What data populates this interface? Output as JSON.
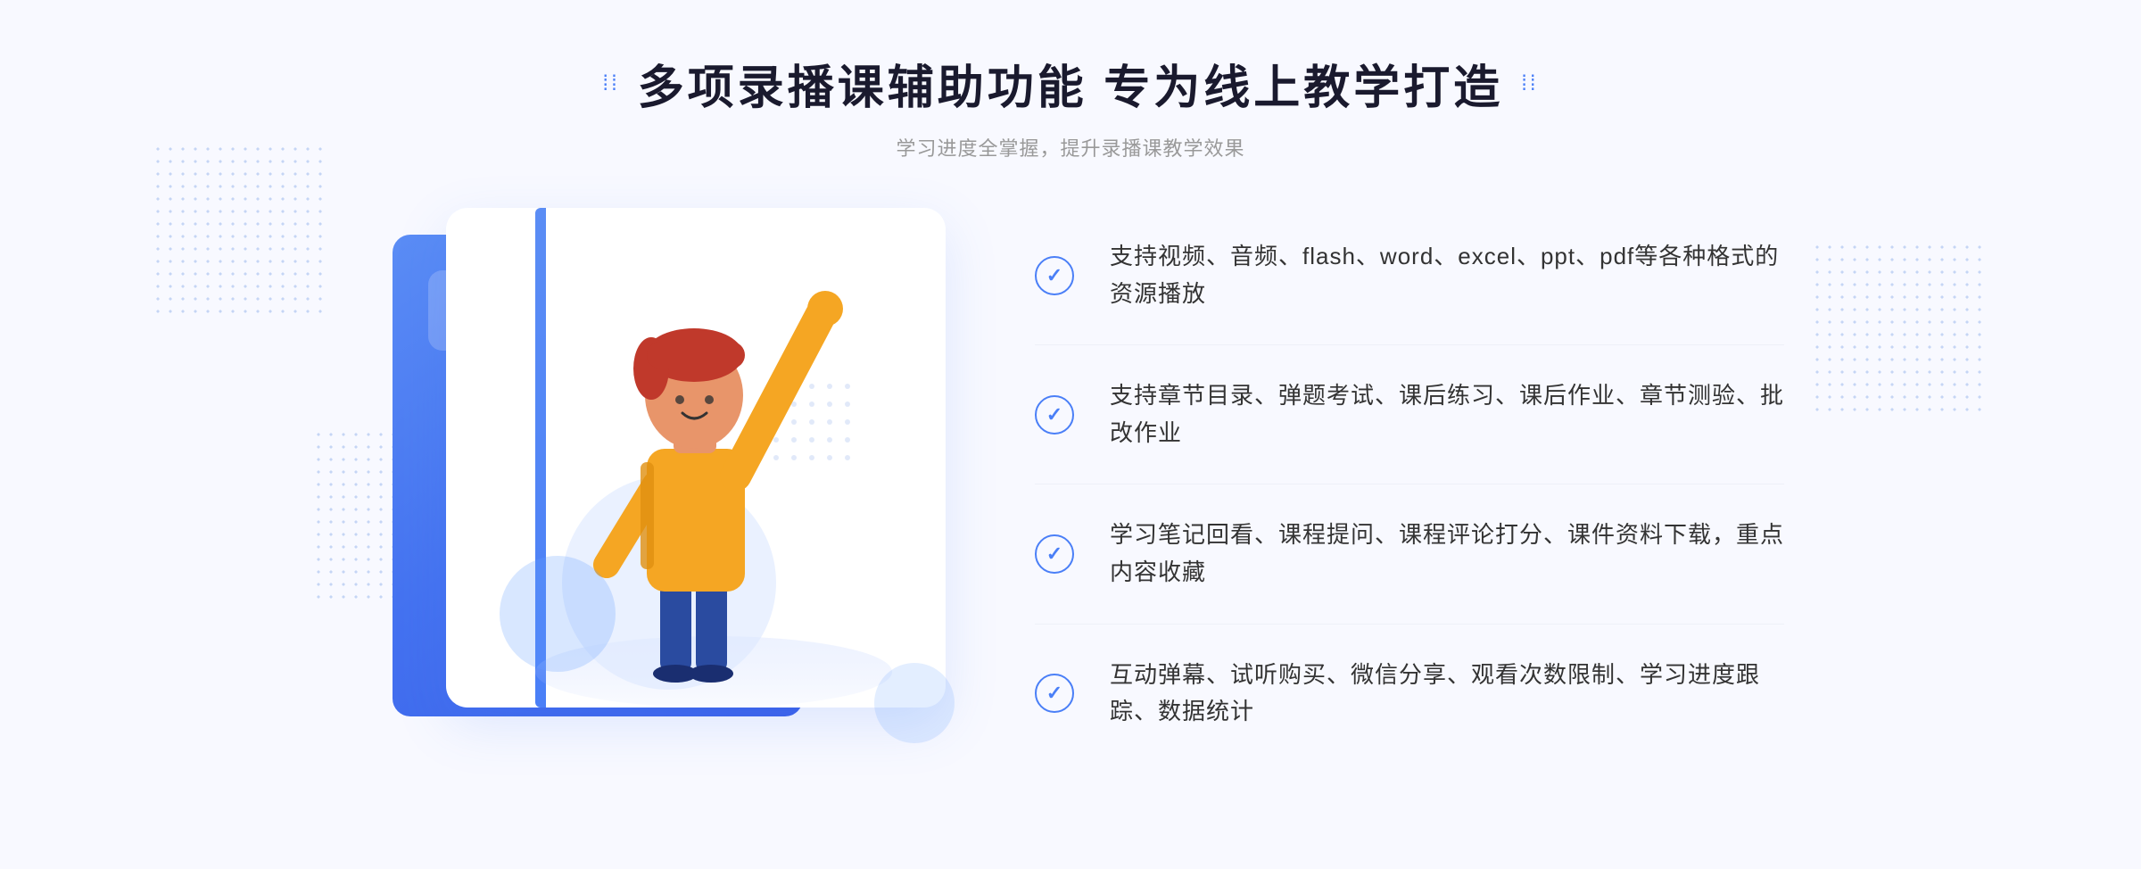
{
  "header": {
    "title": "多项录播课辅助功能 专为线上教学打造",
    "subtitle": "学习进度全掌握，提升录播课教学效果",
    "dots_left": "⁞⁞",
    "dots_right": "⁞⁞"
  },
  "features": [
    {
      "id": 1,
      "text": "支持视频、音频、flash、word、excel、ppt、pdf等各种格式的资源播放"
    },
    {
      "id": 2,
      "text": "支持章节目录、弹题考试、课后练习、课后作业、章节测验、批改作业"
    },
    {
      "id": 3,
      "text": "学习笔记回看、课程提问、课程评论打分、课件资料下载，重点内容收藏"
    },
    {
      "id": 4,
      "text": "互动弹幕、试听购买、微信分享、观看次数限制、学习进度跟踪、数据统计"
    }
  ],
  "colors": {
    "primary": "#4a7ff7",
    "primary_dark": "#3a60e8",
    "text_dark": "#1a1a2e",
    "text_gray": "#999999",
    "text_body": "#333333",
    "bg_light": "#f8f9ff"
  }
}
